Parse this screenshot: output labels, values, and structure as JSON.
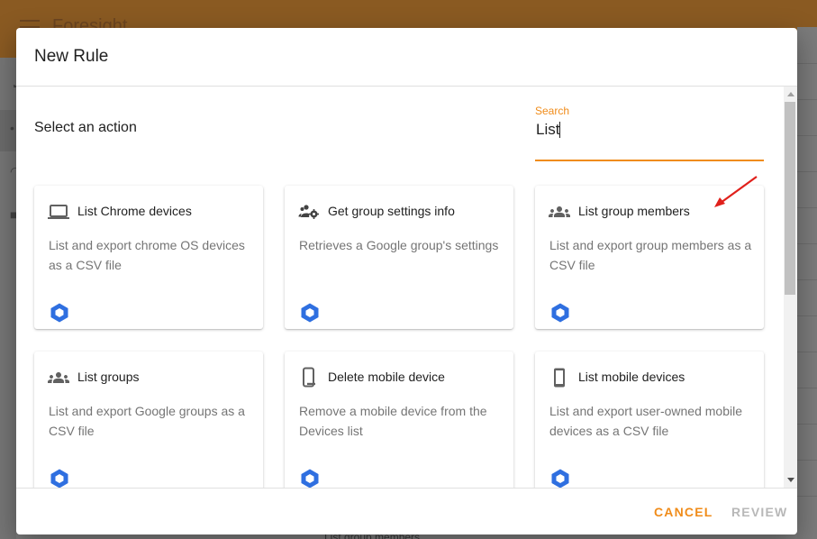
{
  "app": {
    "title": "Foresight",
    "bottom_hint": "List group members"
  },
  "dialog": {
    "title": "New Rule",
    "section_label": "Select an action",
    "search": {
      "label": "Search",
      "value": "List"
    },
    "cards": [
      {
        "title": "List Chrome devices",
        "description": "List and export chrome OS devices as a CSV file",
        "icon": "laptop-icon"
      },
      {
        "title": "Get group settings info",
        "description": "Retrieves a Google group's settings",
        "icon": "group-settings-icon"
      },
      {
        "title": "List group members",
        "description": "List and export group members as a CSV file",
        "icon": "group-icon"
      },
      {
        "title": "List groups",
        "description": "List and export Google groups as a CSV file",
        "icon": "group-icon"
      },
      {
        "title": "Delete mobile device",
        "description": "Remove a mobile device from the Devices list",
        "icon": "mobile-remove-icon"
      },
      {
        "title": "List mobile devices",
        "description": "List and export user-owned mobile devices as a CSV file",
        "icon": "smartphone-icon"
      }
    ],
    "footer": {
      "cancel_label": "CANCEL",
      "review_label": "REVIEW"
    }
  },
  "colors": {
    "accent": "#f08c1a",
    "app_bar": "#8a5a22",
    "provider_logo": "#2f6fe0",
    "annotation_arrow": "#e0201b"
  }
}
